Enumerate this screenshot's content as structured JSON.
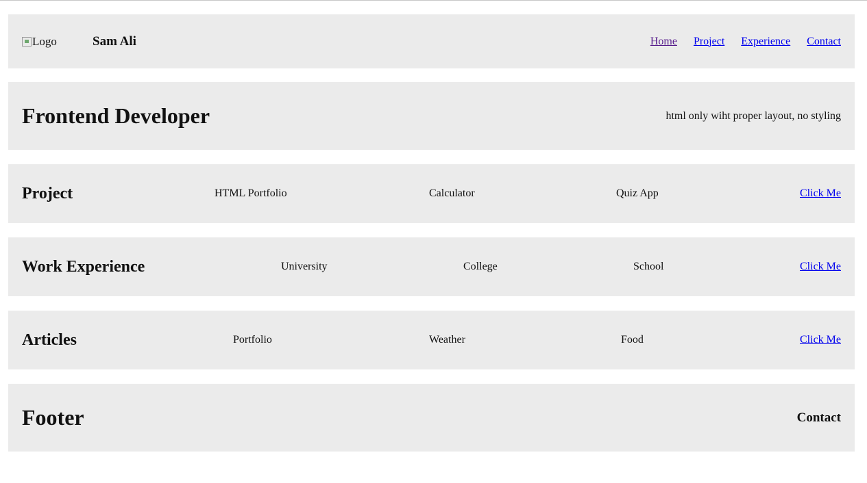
{
  "header": {
    "logo_alt": "Logo",
    "brand": "Sam Ali",
    "nav": [
      "Home",
      "Project",
      "Experience",
      "Contact"
    ]
  },
  "hero": {
    "title": "Frontend Developer",
    "note": "html only wiht proper layout, no styling"
  },
  "projects": {
    "title": "Project",
    "items": [
      "HTML Portfolio",
      "Calculator",
      "Quiz App"
    ],
    "cta": "Click Me"
  },
  "experience": {
    "title": "Work Experience",
    "items": [
      "University",
      "College",
      "School"
    ],
    "cta": "Click Me"
  },
  "articles": {
    "title": "Articles",
    "items": [
      "Portfolio",
      "Weather",
      "Food"
    ],
    "cta": "Click Me"
  },
  "footer": {
    "title": "Footer",
    "contact": "Contact"
  }
}
